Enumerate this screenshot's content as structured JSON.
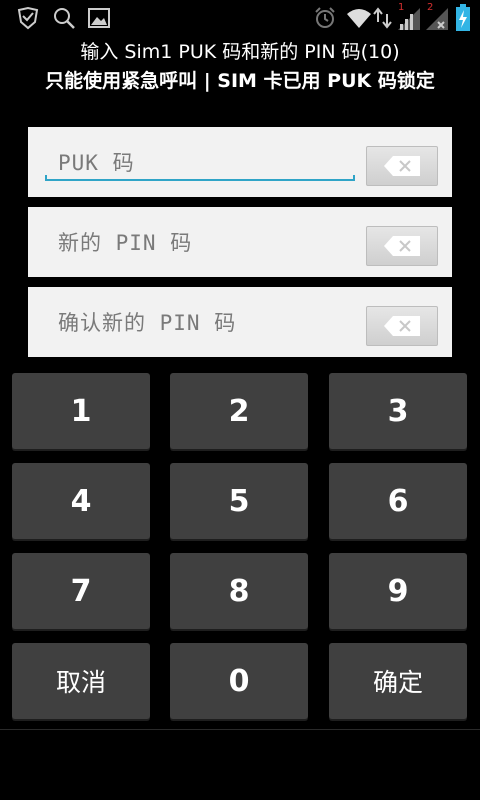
{
  "status_bar": {
    "icons": [
      "shield-check-icon",
      "search-icon",
      "picture-icon",
      "alarm-icon",
      "wifi-icon",
      "data-arrows-icon",
      "signal-sim1-icon",
      "signal-sim2-icon",
      "battery-charging-icon"
    ],
    "sim1_label": "1",
    "sim2_label": "2"
  },
  "header": {
    "line1": "输入 Sim1 PUK 码和新的 PIN 码(10)",
    "line2": "只能使用紧急呼叫 | SIM 卡已用 PUK 码锁定"
  },
  "fields": [
    {
      "placeholder": "PUK 码",
      "focused": true
    },
    {
      "placeholder": "新的 PIN 码",
      "focused": false
    },
    {
      "placeholder": "确认新的 PIN 码",
      "focused": false
    }
  ],
  "keypad": {
    "k1": "1",
    "k2": "2",
    "k3": "3",
    "k4": "4",
    "k5": "5",
    "k6": "6",
    "k7": "7",
    "k8": "8",
    "k9": "9",
    "cancel": "取消",
    "k0": "0",
    "ok": "确定"
  },
  "colors": {
    "accent": "#2fa4c7",
    "key_bg": "#404040",
    "field_bg": "#f2f2f2",
    "battery": "#33b5e5",
    "sim_badge": "#d32f2f"
  }
}
